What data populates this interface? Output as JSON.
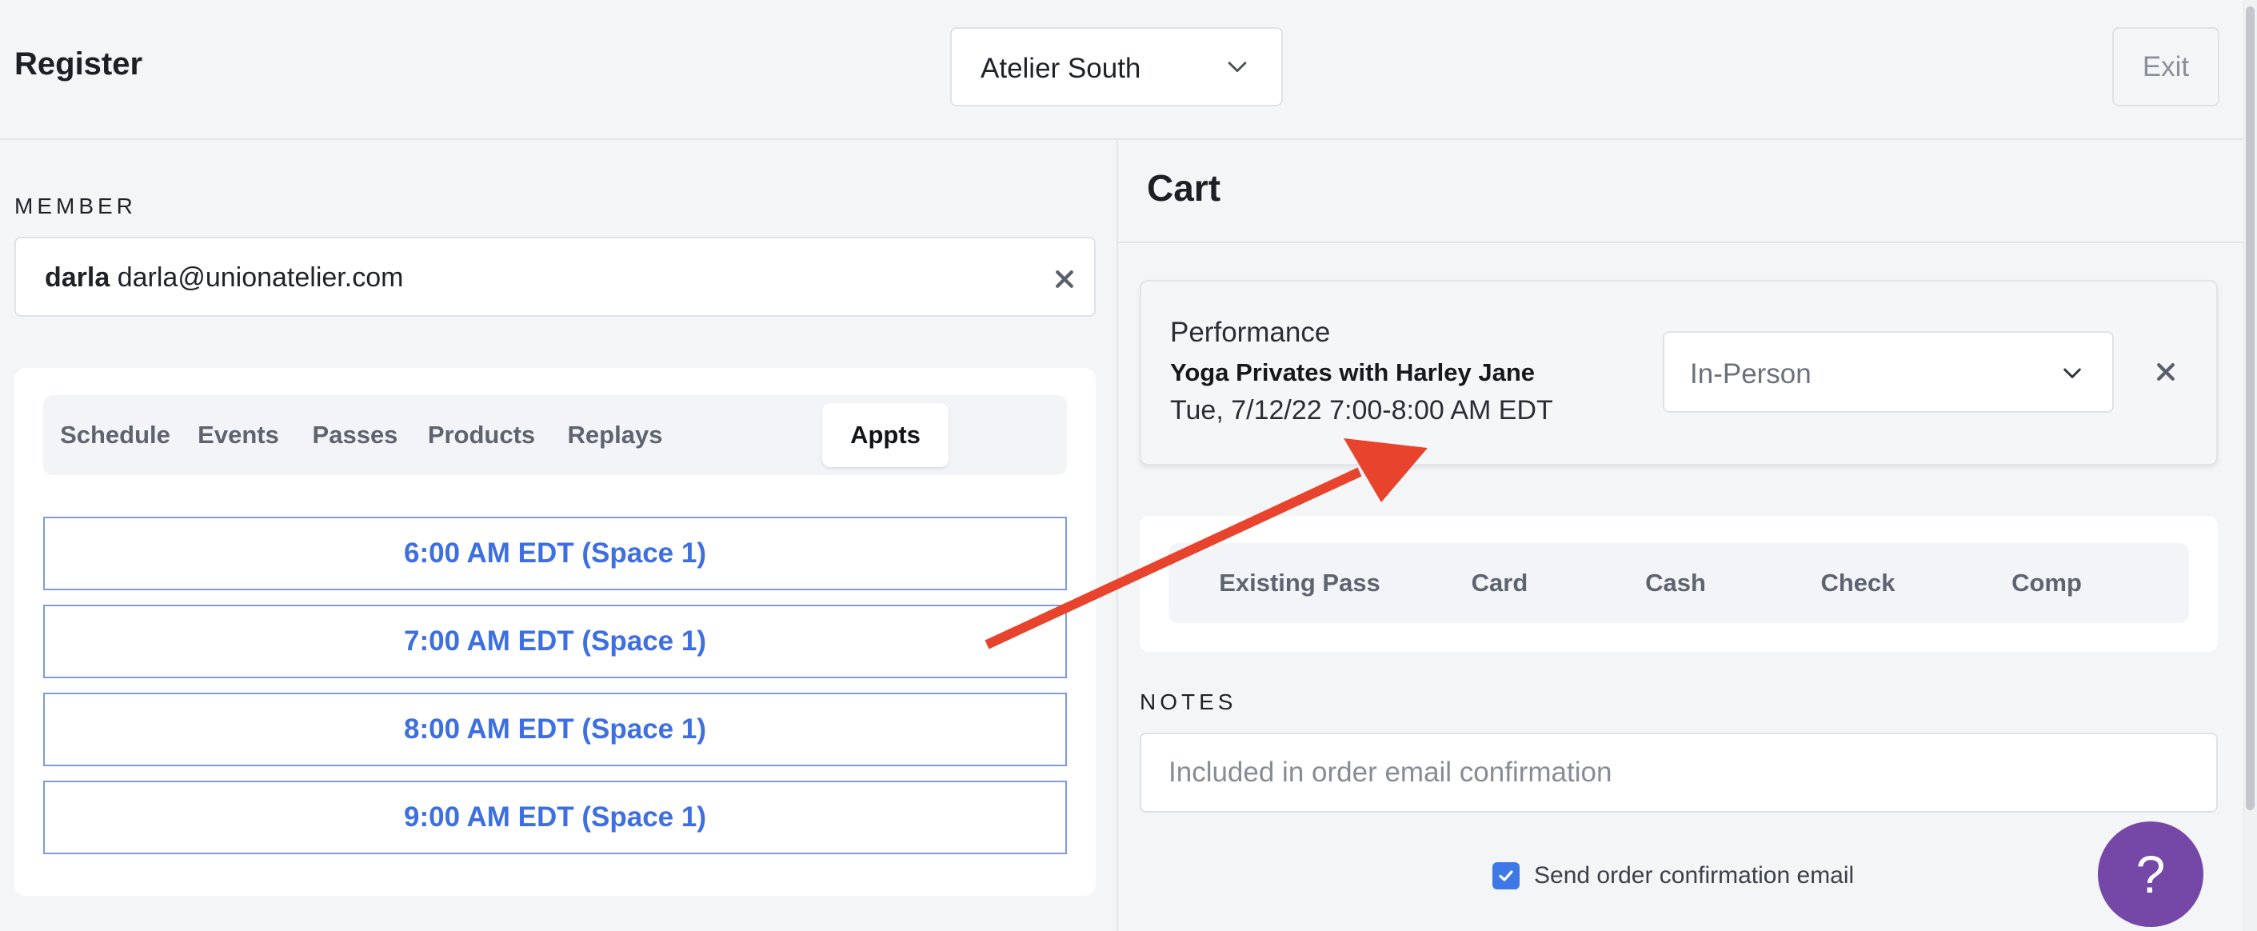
{
  "header": {
    "title": "Register",
    "location": "Atelier South",
    "exit_label": "Exit"
  },
  "member": {
    "label": "MEMBER",
    "name": "darla",
    "email": "darla@unionatelier.com"
  },
  "tabs": [
    {
      "label": "Schedule",
      "active": false
    },
    {
      "label": "Events",
      "active": false
    },
    {
      "label": "Passes",
      "active": false
    },
    {
      "label": "Products",
      "active": false
    },
    {
      "label": "Replays",
      "active": false
    },
    {
      "label": "Appts",
      "active": true
    }
  ],
  "slots": [
    "6:00 AM EDT (Space 1)",
    "7:00 AM EDT (Space 1)",
    "8:00 AM EDT (Space 1)",
    "9:00 AM EDT (Space 1)"
  ],
  "cart": {
    "title": "Cart",
    "item": {
      "type": "Performance",
      "title": "Yoga Privates with Harley Jane",
      "when": "Tue, 7/12/22 7:00-8:00 AM EDT",
      "mode": "In-Person"
    },
    "payment_methods": [
      "Existing Pass",
      "Card",
      "Cash",
      "Check",
      "Comp"
    ]
  },
  "notes": {
    "label": "NOTES",
    "placeholder": "Included in order email confirmation"
  },
  "confirmation": {
    "label": "Send order confirmation email",
    "checked": true
  },
  "help_label": "?",
  "colors": {
    "accent": "#3d6fe0",
    "help_button": "#7547a6",
    "annotation_arrow": "#e8432c"
  }
}
